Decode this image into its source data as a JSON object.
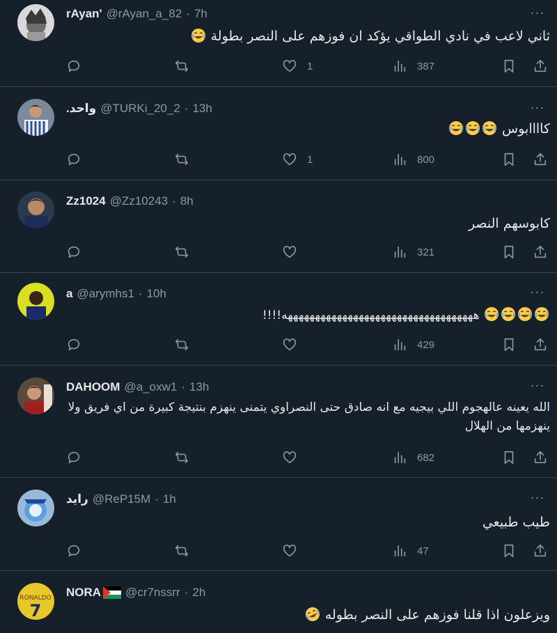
{
  "tweets": [
    {
      "name": "rAyan'",
      "handle": "@rAyan_a_82",
      "time": "7h",
      "text": "ثاني لاعب في نادي الطواقي يؤكد ان فوزهم على النصر بطولة",
      "emoji": [
        "joy"
      ],
      "replies": "",
      "retweets": "",
      "likes": "1",
      "views": "387"
    },
    {
      "name": ".واحد",
      "handle": "@TURKi_20_2",
      "time": "13h",
      "text": "كاااابوس",
      "emoji": [
        "joy",
        "joy",
        "joy"
      ],
      "replies": "",
      "retweets": "",
      "likes": "1",
      "views": "800"
    },
    {
      "name": "Zz1024",
      "handle": "@Zz10243",
      "time": "8h",
      "text": "كابوسهم النصر",
      "emoji": [],
      "replies": "",
      "retweets": "",
      "likes": "",
      "views": "321"
    },
    {
      "name": "a",
      "handle": "@arymhs1",
      "time": "10h",
      "text": "هههههههههههههههههههههههههههههههههههه!!!!",
      "emoji": [
        "joy",
        "joy",
        "joy",
        "joy"
      ],
      "replies": "",
      "retweets": "",
      "likes": "",
      "views": "429"
    },
    {
      "name": "DAHOOM",
      "handle": "@a_oxw1",
      "time": "13h",
      "text": "الله يعينه عالهجوم اللي بيجيه مع انه صادق حتى النصراوي يتمنى ينهزم بنتيجة كبيرة من اي فريق ولا ينهزمها من الهلال",
      "emoji": [],
      "replies": "",
      "retweets": "",
      "likes": "",
      "views": "682"
    },
    {
      "name": "رايد",
      "handle": "@ReP15M",
      "time": "1h",
      "text": "طيب طبيعي",
      "emoji": [],
      "replies": "",
      "retweets": "",
      "likes": "",
      "views": "47"
    },
    {
      "name": "NORA",
      "handle": "@cr7nssrr",
      "time": "2h",
      "text": "ويزعلون اذا قلنا فوزهم على النصر بطوله",
      "emoji": [
        "rofl"
      ],
      "replies": "",
      "retweets": "",
      "likes": "",
      "views": ""
    }
  ],
  "colors": {
    "background": "#15202b",
    "text": "#e7e9ea",
    "muted": "#8b98a5",
    "divider": "#38444d"
  },
  "icons": [
    "reply-icon",
    "retweet-icon",
    "like-icon",
    "views-icon",
    "bookmark-icon",
    "share-icon",
    "more-icon"
  ]
}
